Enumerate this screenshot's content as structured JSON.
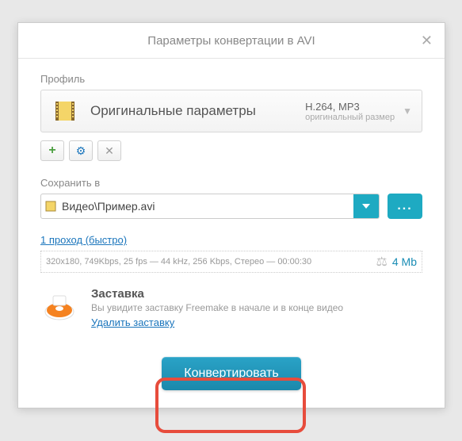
{
  "dialog": {
    "title": "Параметры конвертации в AVI"
  },
  "profile": {
    "label": "Профиль",
    "name": "Оригинальные параметры",
    "codec": "H.264, MP3",
    "sizeLabel": "оригинальный размер"
  },
  "saveTo": {
    "label": "Сохранить в",
    "path": "Видео\\Пример.avi"
  },
  "pass": {
    "link": "1 проход (быстро)",
    "tech": "320x180, 749Kbps, 25 fps — 44 kHz, 256 Kbps, Стерео — 00:00:30",
    "size": "4 Mb"
  },
  "splash": {
    "title": "Заставка",
    "desc": "Вы увидите заставку Freemake в начале и в конце видео",
    "remove": "Удалить заставку"
  },
  "actions": {
    "convert": "Конвертировать"
  }
}
